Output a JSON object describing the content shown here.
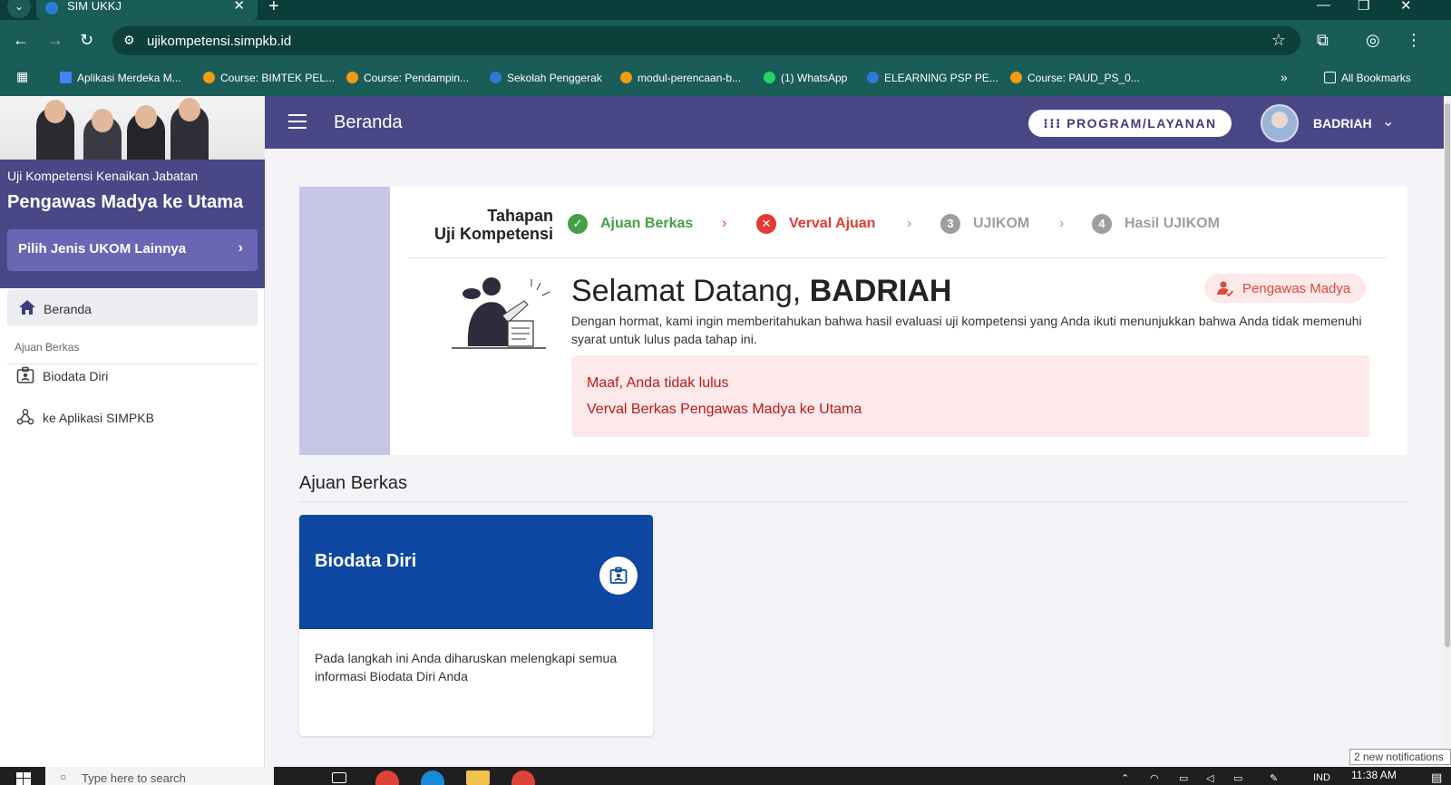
{
  "browser": {
    "tab_title": "SIM UKKJ",
    "url": "ujikompetensi.simpkb.id",
    "bookmarks": [
      "Aplikasi Merdeka M...",
      "Course: BIMTEK PEL...",
      "Course: Pendampin...",
      "Sekolah Penggerak",
      "modul-perencaan-b...",
      "(1) WhatsApp",
      "ELEARNING PSP PE...",
      "Course: PAUD_PS_0..."
    ],
    "overflow": "»",
    "all_bookmarks": "All Bookmarks"
  },
  "header": {
    "title": "Beranda",
    "program_button": "PROGRAM/LAYANAN",
    "user_name": "BADRIAH"
  },
  "sidebar": {
    "subtitle": "Uji Kompetensi Kenaikan Jabatan",
    "title": "Pengawas Madya ke Utama",
    "choose_button": "Pilih Jenis UKOM Lainnya",
    "home": "Beranda",
    "section": "Ajuan Berkas",
    "items": [
      "Biodata Diri",
      "ke Aplikasi SIMPKB"
    ]
  },
  "stages": {
    "title_line1": "Tahapan",
    "title_line2": "Uji Kompetensi",
    "steps": [
      {
        "label": "Ajuan Berkas",
        "marker": "✓",
        "status": "done",
        "color": "#43a047"
      },
      {
        "label": "Verval Ajuan",
        "marker": "✕",
        "status": "failed",
        "color": "#e53935"
      },
      {
        "label": "UJIKOM",
        "marker": "3",
        "status": "pending",
        "color": "#9e9e9e"
      },
      {
        "label": "Hasil UJIKOM",
        "marker": "4",
        "status": "pending",
        "color": "#9e9e9e"
      }
    ]
  },
  "welcome": {
    "greeting": "Selamat Datang,",
    "name": "BADRIAH",
    "role": "Pengawas Madya",
    "message": "Dengan hormat, kami ingin memberitahukan bahwa hasil evaluasi uji kompetensi yang Anda ikuti menunjukkan bahwa Anda tidak memenuhi syarat untuk lulus pada tahap ini.",
    "alert_line1": "Maaf, Anda tidak lulus",
    "alert_line2": "Verval Berkas Pengawas Madya ke Utama"
  },
  "section": {
    "title": "Ajuan Berkas",
    "card_title": "Biodata Diri",
    "card_desc": "Pada langkah ini Anda diharuskan melengkapi semua informasi Biodata Diri Anda"
  },
  "notification": "2 new notifications",
  "taskbar": {
    "search_placeholder": "Type here to search",
    "time": "11:38 AM",
    "lang": "IND"
  },
  "colors": {
    "header": "#4a4786",
    "browser": "#1a5c57",
    "card_head": "#0d47a1",
    "alert_bg": "#fde8ea",
    "alert_text": "#b71c1c"
  }
}
